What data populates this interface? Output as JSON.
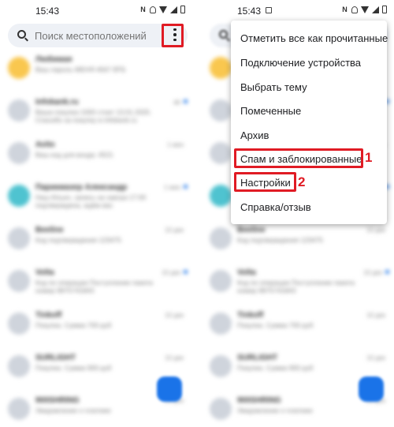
{
  "left_screen": {
    "status_time": "15:43",
    "search_placeholder": "Поиск местоположений",
    "conversations": [
      {
        "name": "Любимая",
        "preview": "Ваш пароль МЕНЯ 4567 ВТБ",
        "time": "",
        "avatar_color": "#f9c74f",
        "unread": false
      },
      {
        "name": "Infobank.ru",
        "preview": "Ваша покупка 1000 стоит 13.01.2025. Спасибо за покупку в infobank.ru",
        "time": "ab",
        "avatar_color": "#cfd4dc",
        "unread": true
      },
      {
        "name": "Avito",
        "preview": "Ваш код для входа: 4521",
        "time": "1 мин",
        "avatar_color": "#cfd4dc",
        "unread": false
      },
      {
        "name": "Парикмахер Александр",
        "preview": "Наш Ильич, запись на завтра 17:00 подтверждена, ждём вас",
        "time": "1 мин",
        "avatar_color": "#4fc3d0",
        "unread": true
      },
      {
        "name": "Beeline",
        "preview": "Код подтверждения 123475",
        "time": "10 дек",
        "avatar_color": "#cfd4dc",
        "unread": false
      },
      {
        "name": "Volta",
        "preview": "Код по операции Поступление пакета номер 9975741843",
        "time": "10 дек",
        "avatar_color": "#cfd4dc",
        "unread": true
      },
      {
        "name": "Tinkoff",
        "preview": "Покупка. Сумма 700 руб",
        "time": "10 дек",
        "avatar_color": "#cfd4dc",
        "unread": false
      },
      {
        "name": "SURLIGHT",
        "preview": "Покупка. Сумма 900 руб",
        "time": "10 дек",
        "avatar_color": "#cfd4dc",
        "unread": false
      },
      {
        "name": "900SHRING",
        "preview": "Уведомление о платеже",
        "time": "10 дек",
        "avatar_color": "#cfd4dc",
        "unread": false
      }
    ]
  },
  "right_screen": {
    "status_time": "15:43",
    "menu_items": [
      "Отметить все как прочитанные",
      "Подключение устройства",
      "Выбрать тему",
      "Помеченные",
      "Архив",
      "Спам и заблокированные",
      "Настройки",
      "Справка/отзыв"
    ],
    "annotations": [
      "1",
      "2"
    ]
  },
  "colors": {
    "annotation_red": "#e01b24",
    "accent_blue": "#1a73e8",
    "search_bg": "#eef1f6"
  }
}
